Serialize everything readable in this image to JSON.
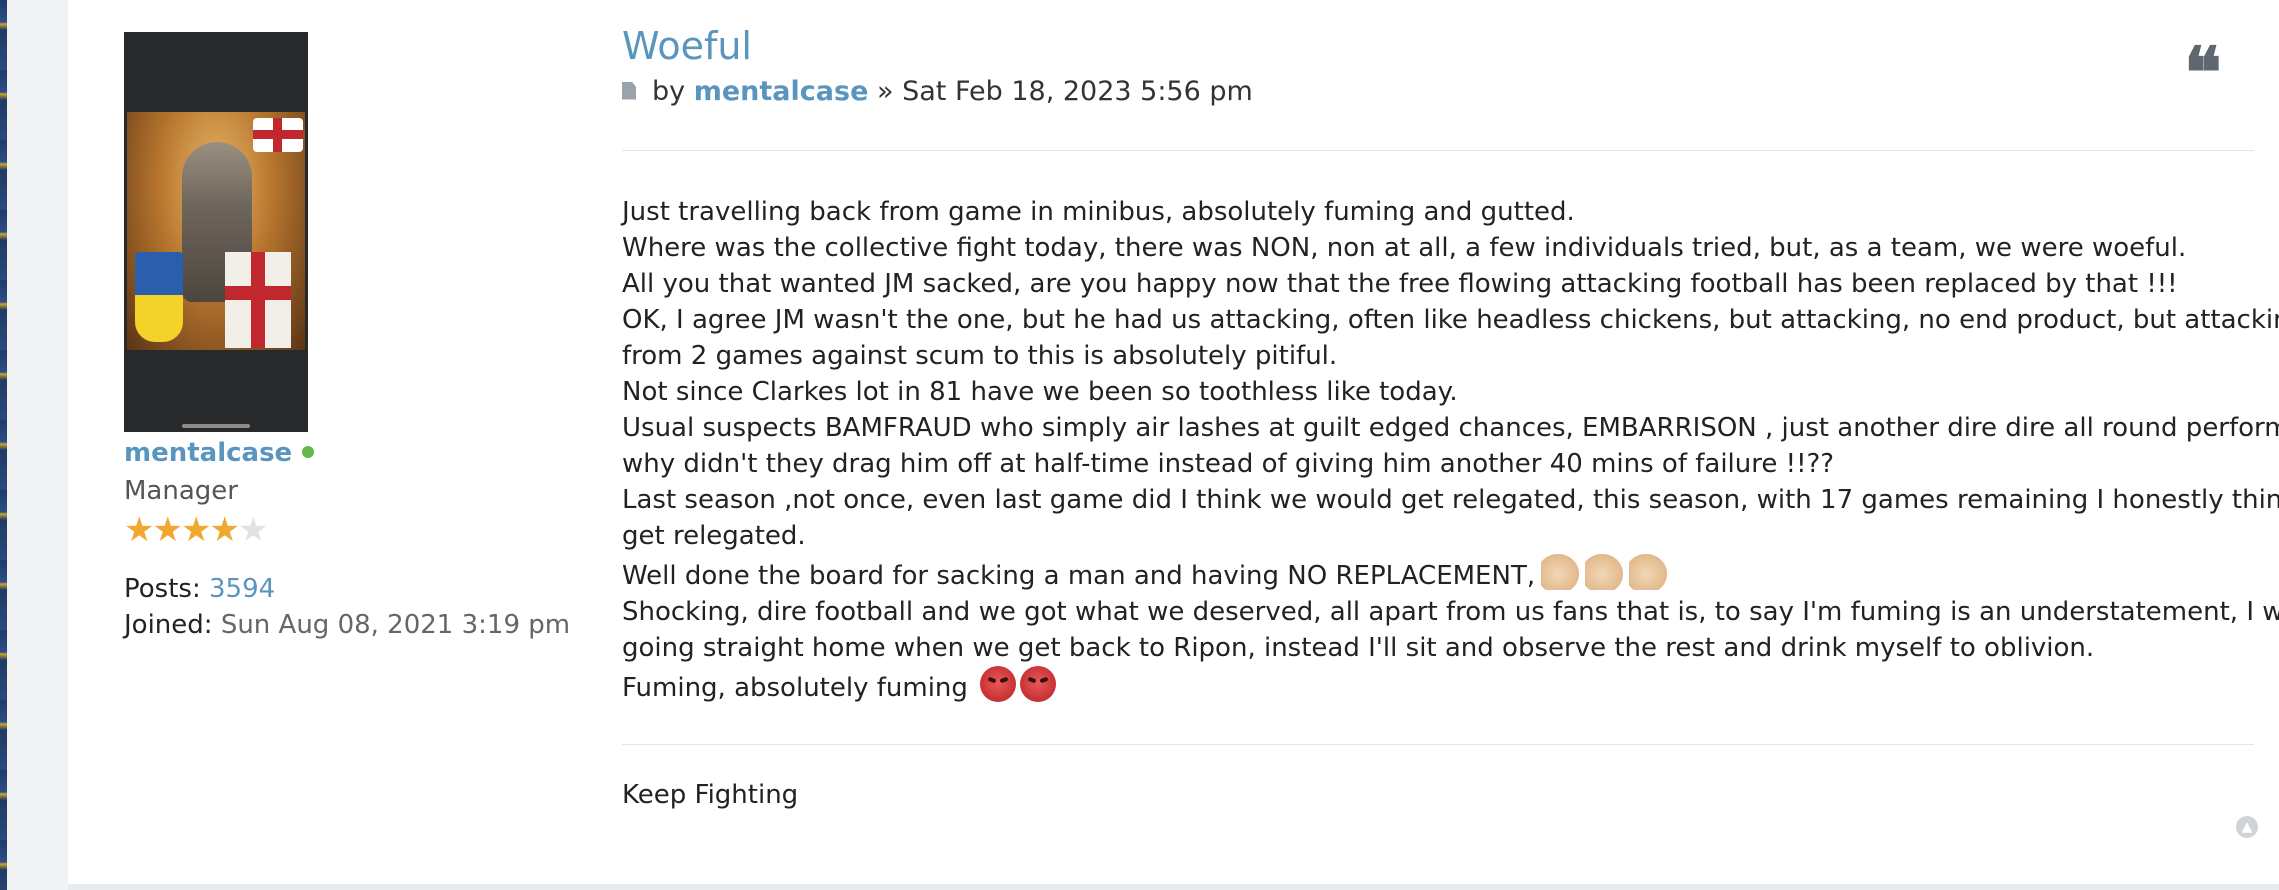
{
  "profile": {
    "username": "mentalcase",
    "rank": "Manager",
    "rating": 4,
    "rating_max": 5,
    "posts_label": "Posts:",
    "posts_value": "3594",
    "joined_label": "Joined:",
    "joined_value": "Sun Aug 08, 2021 3:19 pm",
    "online_status_color": "#64b94b"
  },
  "post": {
    "title": "Woeful",
    "by_label": "by",
    "author": "mentalcase",
    "separator": "»",
    "date": "Sat Feb 18, 2023 5:56 pm",
    "quote_icon": "quote-icon",
    "lines": [
      "Just travelling back from game in minibus, absolutely fuming and gutted.",
      "Where was the collective fight today, there was NON, non at all, a few individuals tried, but, as a team, we were woeful.",
      "All you that wanted JM sacked, are you happy now that the free flowing attacking football has been replaced by that !!!",
      "OK, I agree JM wasn't the one, but he had us attacking, often like headless chickens, but attacking, no end product, but attacking,",
      "from 2 games against scum to this is absolutely pitiful.",
      "Not since Clarkes lot in 81 have we been so toothless like today.",
      "Usual suspects BAMFRAUD who simply air lashes at guilt edged chances, EMBARRISON , just another dire dire all round performance,",
      "why didn't they drag him off at half-time instead of giving him another 40 mins of failure !!??",
      "Last season ,not once, even last game did I think we would get relegated, this season, with 17 games remaining I honestly think we'll",
      "get relegated.",
      "Well done the board for sacking a man and having NO REPLACEMENT,",
      "Shocking, dire football and we got what we deserved, all apart from us fans that is, to say I'm fuming is an understatement, I won't be",
      "going straight home when we get back to Ripon, instead I'll sit and observe the rest and drink myself to oblivion.",
      "Fuming, absolutely fuming"
    ],
    "signature": "Keep Fighting"
  },
  "colors": {
    "link": "#5a95bf",
    "star": "#f0a830"
  }
}
